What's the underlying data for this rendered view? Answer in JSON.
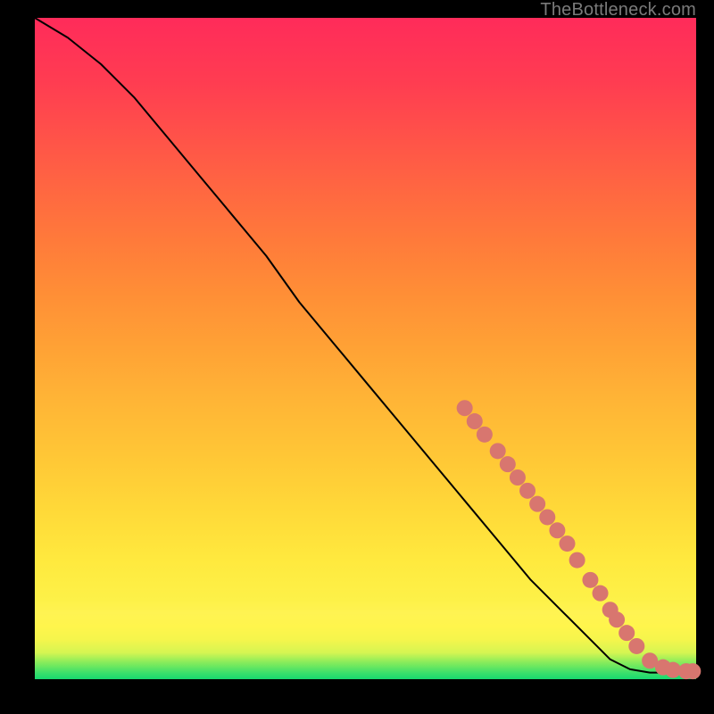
{
  "attribution": "TheBottleneck.com",
  "chart_data": {
    "type": "line",
    "title": "",
    "xlabel": "",
    "ylabel": "",
    "xlim": [
      0,
      100
    ],
    "ylim": [
      0,
      100
    ],
    "series": [
      {
        "name": "curve",
        "x": [
          0,
          5,
          10,
          15,
          20,
          25,
          30,
          35,
          40,
          45,
          50,
          55,
          60,
          65,
          70,
          75,
          80,
          85,
          87,
          90,
          93,
          95,
          97,
          100
        ],
        "y": [
          100,
          97,
          93,
          88,
          82,
          76,
          70,
          64,
          57,
          51,
          45,
          39,
          33,
          27,
          21,
          15,
          10,
          5,
          3,
          1.5,
          1,
          1,
          1,
          1
        ]
      }
    ],
    "markers": {
      "name": "highlight-dots",
      "color": "#d8766f",
      "points": [
        {
          "x": 65.0,
          "y": 41.0
        },
        {
          "x": 66.5,
          "y": 39.0
        },
        {
          "x": 68.0,
          "y": 37.0
        },
        {
          "x": 70.0,
          "y": 34.5
        },
        {
          "x": 71.5,
          "y": 32.5
        },
        {
          "x": 73.0,
          "y": 30.5
        },
        {
          "x": 74.5,
          "y": 28.5
        },
        {
          "x": 76.0,
          "y": 26.5
        },
        {
          "x": 77.5,
          "y": 24.5
        },
        {
          "x": 79.0,
          "y": 22.5
        },
        {
          "x": 80.5,
          "y": 20.5
        },
        {
          "x": 82.0,
          "y": 18.0
        },
        {
          "x": 84.0,
          "y": 15.0
        },
        {
          "x": 85.5,
          "y": 13.0
        },
        {
          "x": 87.0,
          "y": 10.5
        },
        {
          "x": 88.0,
          "y": 9.0
        },
        {
          "x": 89.5,
          "y": 7.0
        },
        {
          "x": 91.0,
          "y": 5.0
        },
        {
          "x": 93.0,
          "y": 2.8
        },
        {
          "x": 95.0,
          "y": 1.8
        },
        {
          "x": 96.5,
          "y": 1.4
        },
        {
          "x": 98.5,
          "y": 1.2
        },
        {
          "x": 99.5,
          "y": 1.2
        }
      ]
    }
  }
}
